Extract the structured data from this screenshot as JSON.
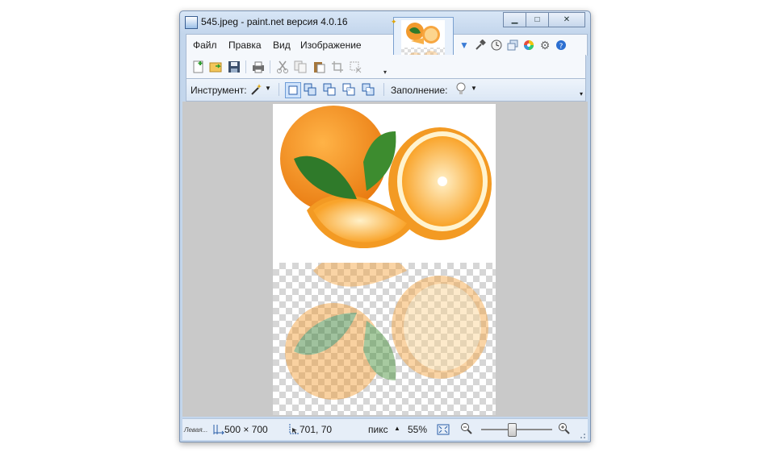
{
  "window": {
    "title": "545.jpeg - paint.net версия 4.0.16",
    "controls": [
      "minimize-icon",
      "maximize-icon",
      "close-icon"
    ]
  },
  "menu": {
    "items": [
      "Файл",
      "Правка",
      "Вид",
      "Изображение"
    ]
  },
  "toolbar": {
    "tool_label": "Инструмент:",
    "fill_label": "Заполнение:",
    "file_buttons": [
      "new-icon",
      "open-icon",
      "save-icon",
      "print-icon",
      "cut-icon",
      "copy-icon",
      "paste-icon",
      "crop-icon",
      "deselect-icon"
    ],
    "selection_modes": [
      "replace-mode-icon",
      "union-mode-icon",
      "exclude-mode-icon",
      "intersect-mode-icon",
      "invert-mode-icon"
    ],
    "right_tools": [
      "tools-icon",
      "history-icon",
      "layers-icon",
      "colors-icon",
      "settings-icon",
      "help-icon"
    ]
  },
  "status": {
    "hint": "Левая...",
    "image_size": "500 × 700",
    "cursor_position": "701, 70",
    "units": "пикс",
    "zoom": "55%",
    "zoom_level": 0.55
  },
  "colors": {
    "accent": "#3a7bd5",
    "orange": "#f5962a",
    "leaf": "#2f7a2a"
  }
}
